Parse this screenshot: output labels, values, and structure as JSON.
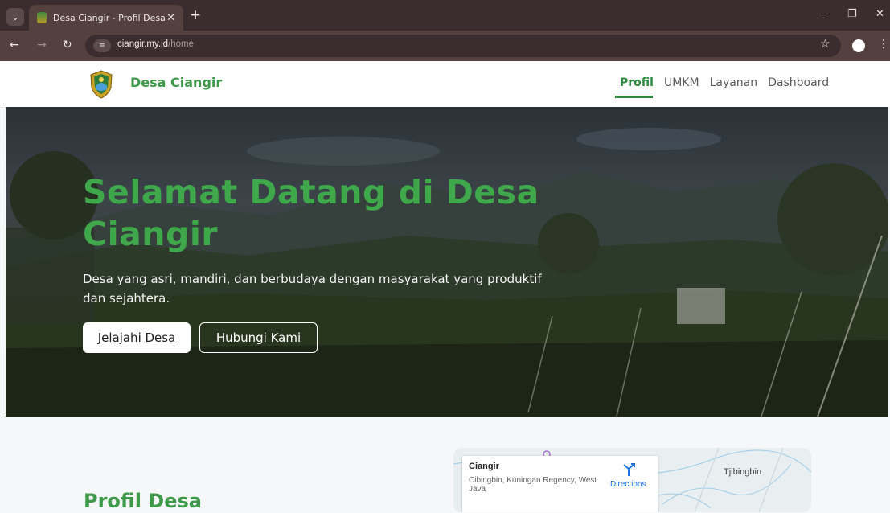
{
  "browser": {
    "tab_title": "Desa Ciangir - Profil Desa",
    "url_host": "ciangir.my.id",
    "url_path": "/home"
  },
  "site": {
    "brand": "Desa Ciangir",
    "nav": [
      "Profil",
      "UMKM",
      "Layanan",
      "Dashboard"
    ],
    "active_nav": "Profil"
  },
  "hero": {
    "title": "Selamat Datang di Desa Ciangir",
    "subtitle": "Desa yang asri, mandiri, dan berbudaya dengan masyarakat yang produktif dan sejahtera.",
    "primary_button": "Jelajahi Desa",
    "secondary_button": "Hubungi Kami"
  },
  "profile": {
    "heading": "Profil Desa"
  },
  "map": {
    "place_label": "Tjibingbin",
    "card_title": "Ciangir",
    "card_address": "Cibingbin, Kuningan Regency, West Java",
    "directions_label": "Directions"
  },
  "colors": {
    "brand_green": "#3e9a4a",
    "chrome_dark": "#3a2c2f",
    "chrome_toolbar": "#54413f"
  }
}
